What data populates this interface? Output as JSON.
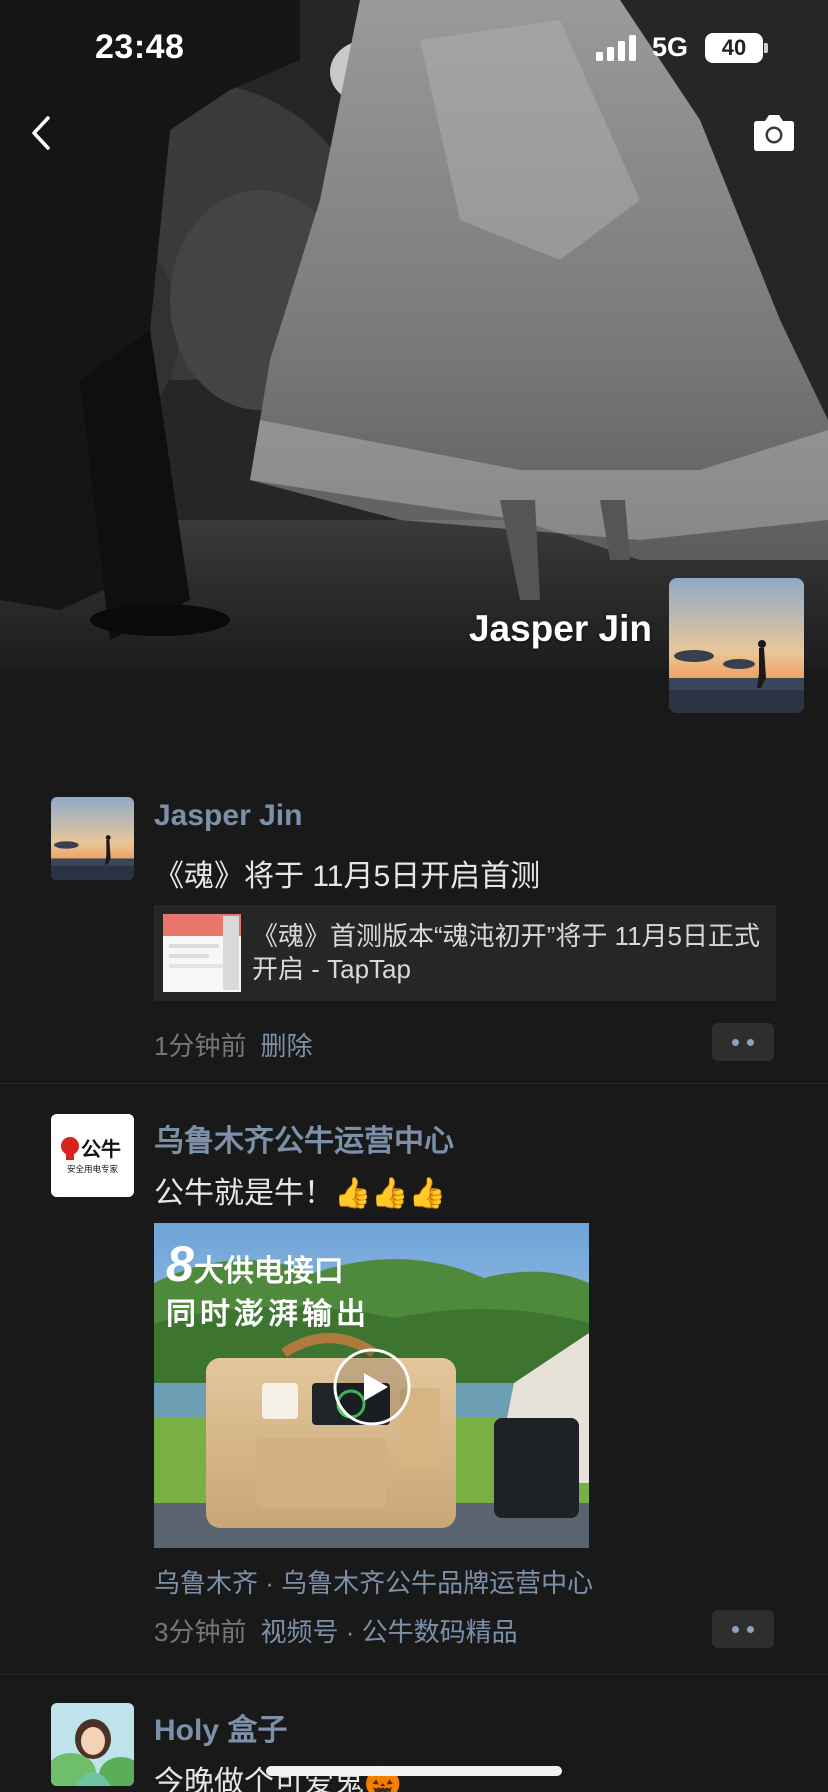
{
  "status_bar": {
    "time": "23:48",
    "network": "5G",
    "battery": "40"
  },
  "profile": {
    "name": "Jasper Jin"
  },
  "posts": [
    {
      "author": "Jasper Jin",
      "text": "《魂》将于 11月5日开启首测",
      "link_title": "《魂》首测版本“魂沌初开”将于 11月5日正式开启 - TapTap",
      "time": "1分钟前",
      "action": "删除"
    },
    {
      "author": "乌鲁木齐公牛运营中心",
      "avatar_text": "公牛",
      "avatar_subtext": "安全用电专家",
      "text": "公牛就是牛！👍👍👍",
      "video_headline_number": "8",
      "video_headline_rest": "大供电接口",
      "video_headline_line2": "同时澎湃输出",
      "source": "乌鲁木齐 · 乌鲁木齐公牛品牌运营中心",
      "time": "3分钟前",
      "channel": "视频号 · 公牛数码精品"
    },
    {
      "author": "Holy 盒子",
      "text": "今晚做个可爱鬼🎃"
    }
  ],
  "icons": [
    "back-icon",
    "camera-icon",
    "more-icon",
    "play-icon",
    "signal-icon"
  ],
  "colors": {
    "background": "#191919",
    "author_link": "#7d90a9",
    "meta": "#777777",
    "card": "#262626"
  }
}
